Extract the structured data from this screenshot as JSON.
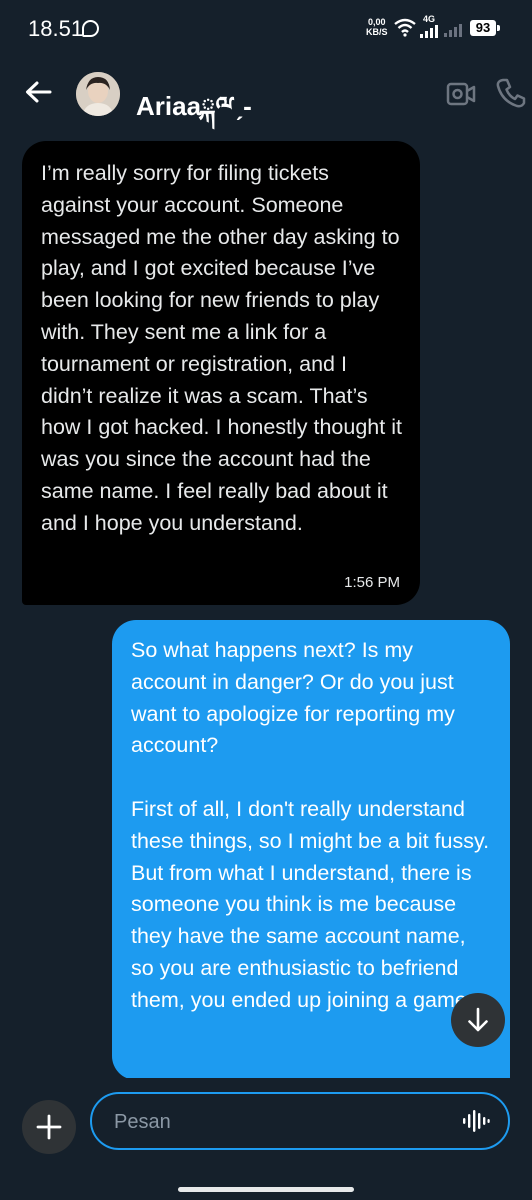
{
  "status_bar": {
    "time": "18.51",
    "speed_value": "0,00",
    "speed_unit": "KB/S",
    "network": "4G",
    "battery": "93"
  },
  "header": {
    "contact_name": "Ariaaྐྋˏ-",
    "icons": [
      "back-arrow-icon",
      "video-call-icon",
      "phone-icon"
    ]
  },
  "messages": [
    {
      "direction": "incoming",
      "text": "I’m really sorry for filing tickets against your account. Someone messaged me the other day asking to play, and I got excited because I’ve been looking for new friends to play with. They sent me a link for a tournament or registration, and I didn’t realize it was a scam. That’s how I got hacked. I honestly thought it was you since the account had the same name. I feel really bad about it and I hope you understand.",
      "time": "1:56 PM"
    },
    {
      "direction": "outgoing",
      "paragraphs": [
        "So what happens next? Is my account in danger? Or do you just want to apologize for reporting my account?",
        "First of all, I don't really understand these things, so I might be a bit fussy. But from what I understand, there is someone you think is me because they have the same account name, so you are enthusiastic to befriend them, you ended up joining a game"
      ]
    }
  ],
  "composer": {
    "placeholder": "Pesan"
  },
  "colors": {
    "background": "#15202b",
    "incoming_bubble": "#000000",
    "outgoing_bubble": "#1d9bf0",
    "accent": "#1d9bf0"
  }
}
